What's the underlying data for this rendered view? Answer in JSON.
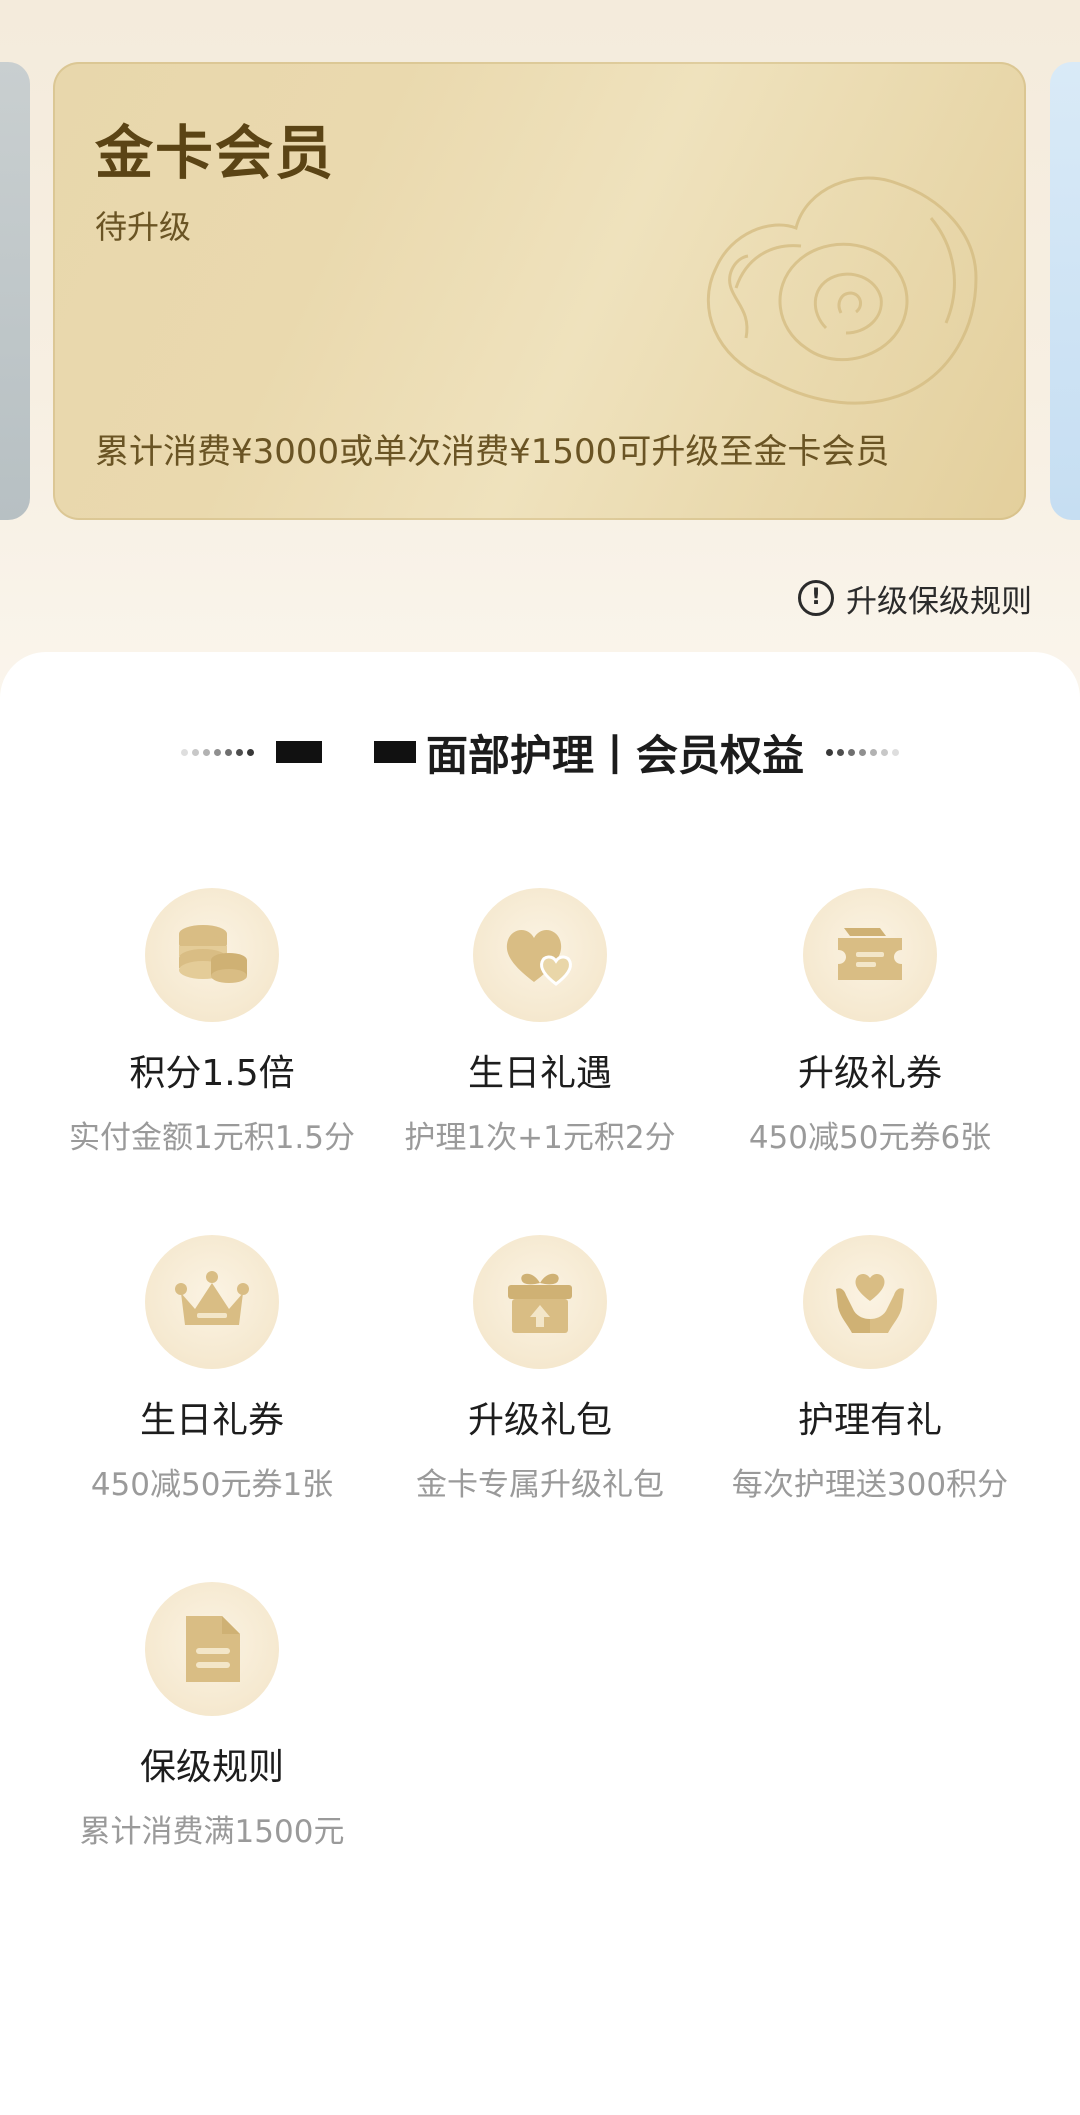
{
  "card": {
    "title": "金卡会员",
    "status": "待升级",
    "description": "累计消费¥3000或单次消费¥1500可升级至金卡会员"
  },
  "rules_link": {
    "icon": "info-circle-icon",
    "label": "升级保级规则"
  },
  "section": {
    "title": "面部护理丨会员权益"
  },
  "benefits": [
    {
      "icon": "coins-icon",
      "name": "积分1.5倍",
      "desc": "实付金额1元积1.5分"
    },
    {
      "icon": "heart-gift-icon",
      "name": "生日礼遇",
      "desc": "护理1次+1元积2分"
    },
    {
      "icon": "ticket-icon",
      "name": "升级礼券",
      "desc": "450减50元券6张"
    },
    {
      "icon": "crown-icon",
      "name": "生日礼券",
      "desc": "450减50元券1张"
    },
    {
      "icon": "gift-box-icon",
      "name": "升级礼包",
      "desc": "金卡专属升级礼包"
    },
    {
      "icon": "hands-heart-icon",
      "name": "护理有礼",
      "desc": "每次护理送300积分"
    },
    {
      "icon": "document-icon",
      "name": "保级规则",
      "desc": "累计消费满1500元"
    }
  ],
  "colors": {
    "gold_text": "#5b4415",
    "icon_gold": "#d9bd84",
    "muted_text": "#9a9a9a"
  }
}
